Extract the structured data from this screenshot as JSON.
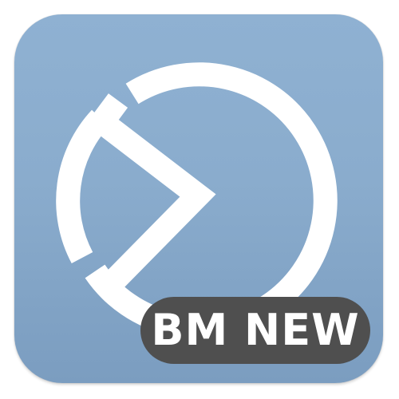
{
  "icon": {
    "background_color": "#8aaccd",
    "glyph_color": "#ffffff",
    "glyph": "play-circle-logo-icon"
  },
  "badge": {
    "label": "BM NEW",
    "background_color": "#4f4f4f",
    "text_color": "#ffffff"
  }
}
